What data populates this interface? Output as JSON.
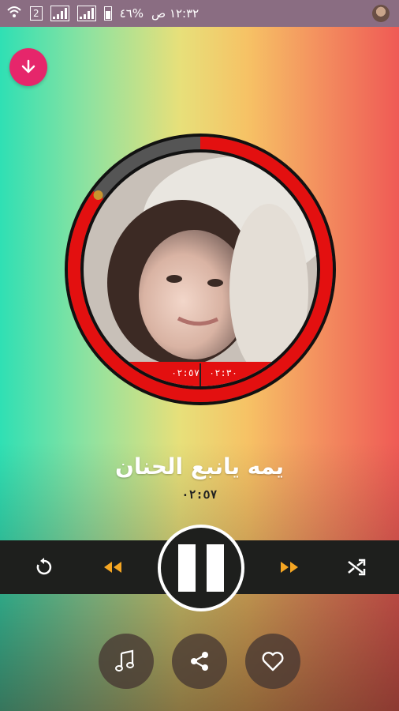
{
  "status_bar": {
    "time": "١٢:٣٢ ص",
    "battery": "%٤٦",
    "sim_slot": "2"
  },
  "download_button": {
    "icon": "download-arrow-icon",
    "color": "#e6266b"
  },
  "player": {
    "elapsed": "٠٢:٣٠",
    "total": "٠٢:٥٧",
    "progress": 0.85,
    "progress_color": "#e31010",
    "title": "يمه يانبع الحنان",
    "duration": "٠٢:٥٧"
  },
  "controls": {
    "repeat_icon": "repeat-icon",
    "rewind_icon": "rewind-icon",
    "pause_icon": "pause-icon",
    "forward_icon": "fast-forward-icon",
    "shuffle_icon": "shuffle-icon",
    "accent_color": "#f5a623"
  },
  "actions": {
    "playlist_icon": "music-note-icon",
    "share_icon": "share-icon",
    "favorite_icon": "heart-icon"
  }
}
